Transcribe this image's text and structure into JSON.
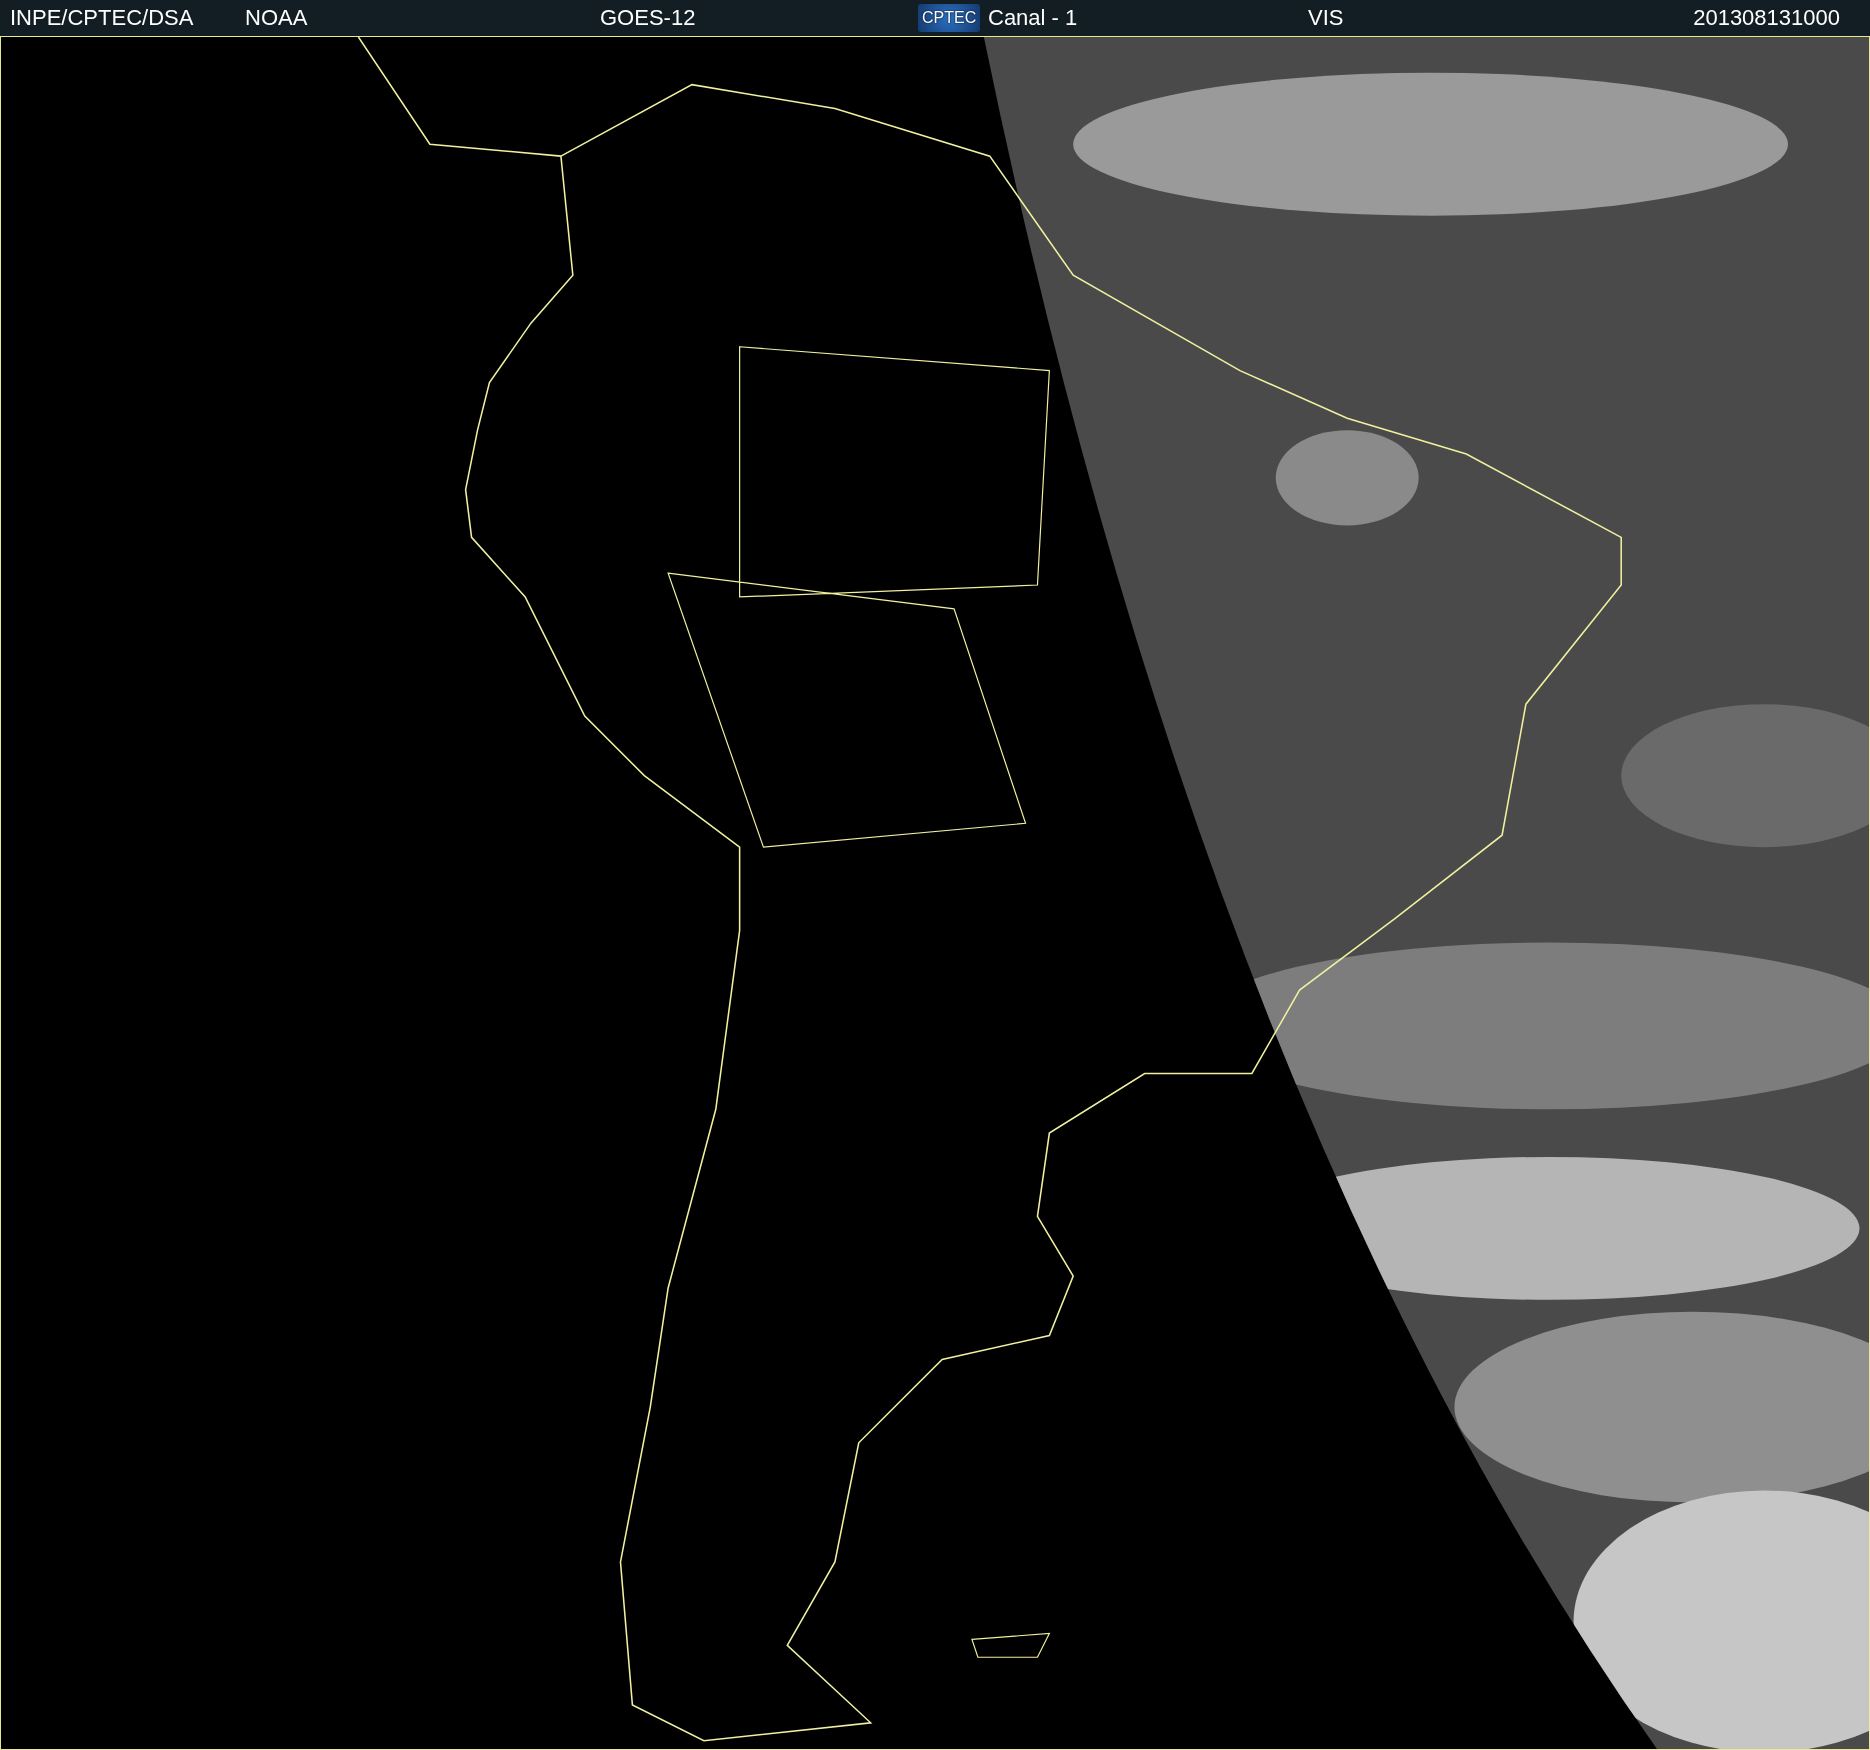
{
  "header": {
    "source": "INPE/CPTEC/DSA",
    "agency": "NOAA",
    "satellite": "GOES-12",
    "logo": "CPTEC",
    "channel": "Canal - 1",
    "band": "VIS",
    "timestamp": "201308131000"
  }
}
